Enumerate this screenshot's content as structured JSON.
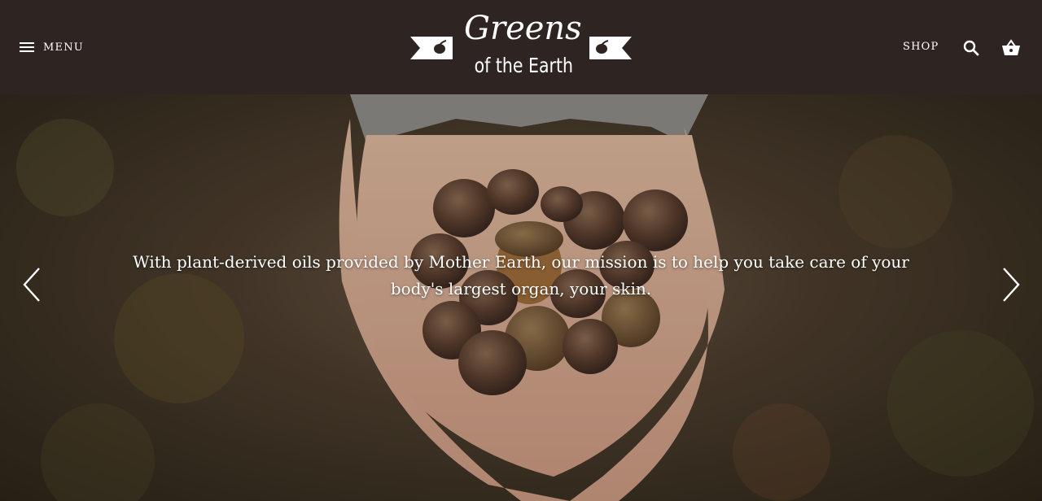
{
  "header": {
    "menu_label": "MENU",
    "menu_icon": "hamburger-icon",
    "logo": {
      "line1": "Greens",
      "line2": "of the Earth"
    },
    "shop_label": "SHOP",
    "search_icon": "search-icon",
    "cart_icon": "basket-icon"
  },
  "hero": {
    "caption": "With plant-derived oils provided by Mother Earth, our mission is to help you take care of your body's largest organ, your skin.",
    "prev_icon": "chevron-left-icon",
    "next_icon": "chevron-right-icon"
  },
  "colors": {
    "header_bg": "#2e2523",
    "text": "#ffffff"
  }
}
